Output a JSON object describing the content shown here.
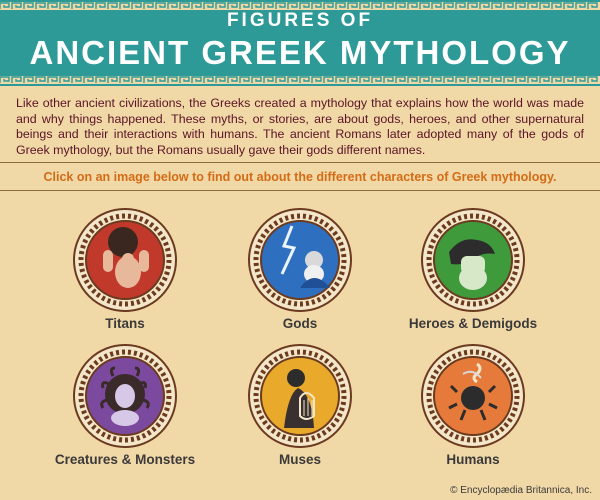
{
  "banner": {
    "line1": "FIGURES OF",
    "line2": "ANCIENT GREEK MYTHOLOGY"
  },
  "intro": "Like other ancient civilizations, the Greeks created a mythology that explains how the world was made and why things happened. These myths, or stories, are about gods, heroes, and other supernatural beings and their interactions with humans. The ancient Romans later adopted many of the gods of Greek mythology, but the Romans usually gave their gods different names.",
  "instruction": "Click on an image below to find out about the different characters of Greek mythology.",
  "categories": [
    {
      "label": "Titans",
      "color": "#c0392b",
      "icon": "titan-icon"
    },
    {
      "label": "Gods",
      "color": "#2f6fc0",
      "icon": "god-icon"
    },
    {
      "label": "Heroes & Demigods",
      "color": "#3f9a3c",
      "icon": "hero-icon"
    },
    {
      "label": "Creatures & Monsters",
      "color": "#7b4a9e",
      "icon": "medusa-icon"
    },
    {
      "label": "Muses",
      "color": "#e9a92a",
      "icon": "muse-icon"
    },
    {
      "label": "Humans",
      "color": "#e57a3a",
      "icon": "human-icon"
    }
  ],
  "credit": "© Encyclopædia Britannica, Inc.",
  "colors": {
    "banner": "#2e9a98",
    "background": "#f1d8a7",
    "intro_text": "#5a1426",
    "instruction": "#d36c17"
  }
}
